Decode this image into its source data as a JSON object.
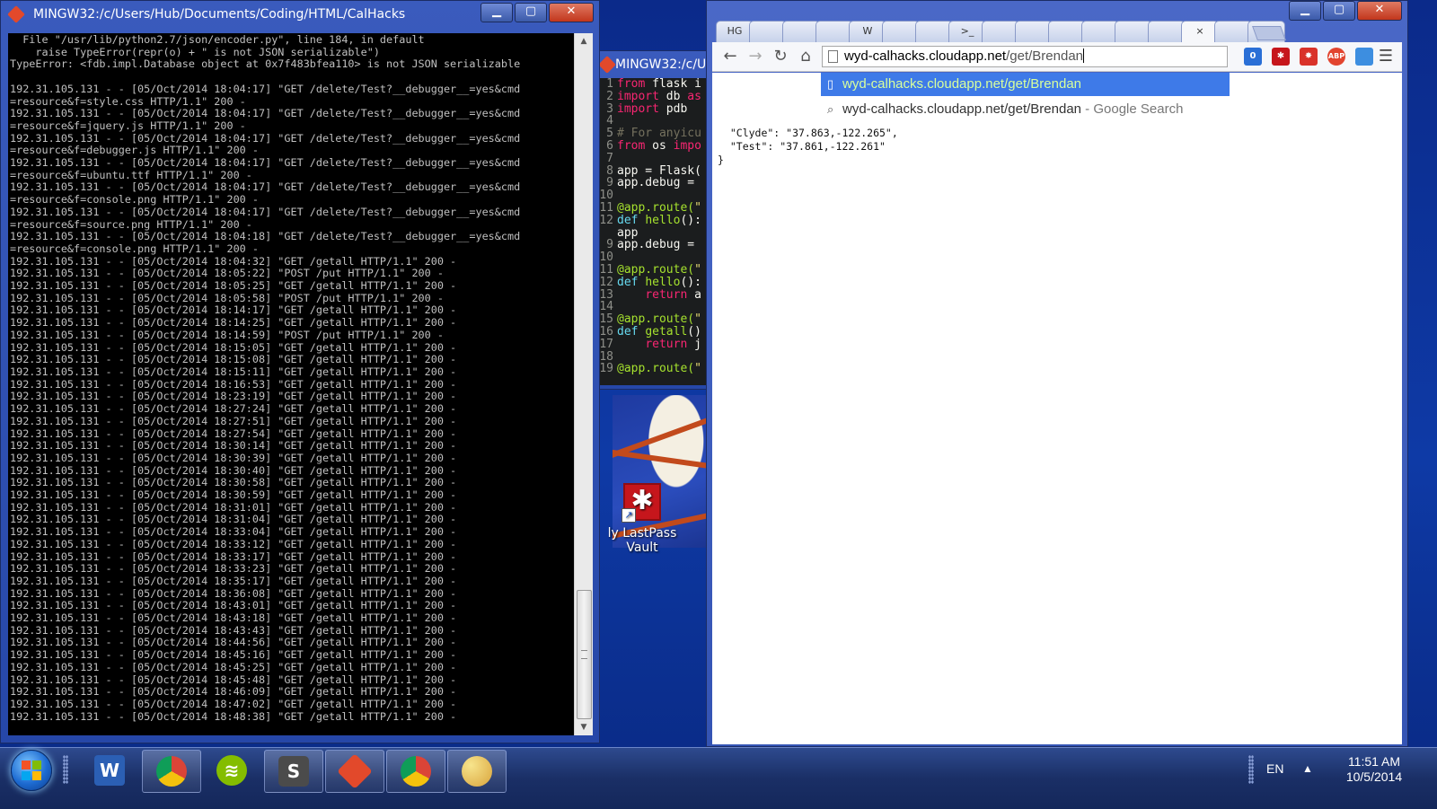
{
  "terminal_main": {
    "title": "MINGW32:/c/Users/Hub/Documents/Coding/HTML/CalHacks",
    "lines": [
      "  File \"/usr/lib/python2.7/json/encoder.py\", line 184, in default",
      "    raise TypeError(repr(o) + \" is not JSON serializable\")",
      "TypeError: <fdb.impl.Database object at 0x7f483bfea110> is not JSON serializable",
      "",
      "192.31.105.131 - - [05/Oct/2014 18:04:17] \"GET /delete/Test?__debugger__=yes&cmd",
      "=resource&f=style.css HTTP/1.1\" 200 -",
      "192.31.105.131 - - [05/Oct/2014 18:04:17] \"GET /delete/Test?__debugger__=yes&cmd",
      "=resource&f=jquery.js HTTP/1.1\" 200 -",
      "192.31.105.131 - - [05/Oct/2014 18:04:17] \"GET /delete/Test?__debugger__=yes&cmd",
      "=resource&f=debugger.js HTTP/1.1\" 200 -",
      "192.31.105.131 - - [05/Oct/2014 18:04:17] \"GET /delete/Test?__debugger__=yes&cmd",
      "=resource&f=ubuntu.ttf HTTP/1.1\" 200 -",
      "192.31.105.131 - - [05/Oct/2014 18:04:17] \"GET /delete/Test?__debugger__=yes&cmd",
      "=resource&f=console.png HTTP/1.1\" 200 -",
      "192.31.105.131 - - [05/Oct/2014 18:04:17] \"GET /delete/Test?__debugger__=yes&cmd",
      "=resource&f=source.png HTTP/1.1\" 200 -",
      "192.31.105.131 - - [05/Oct/2014 18:04:18] \"GET /delete/Test?__debugger__=yes&cmd",
      "=resource&f=console.png HTTP/1.1\" 200 -",
      "192.31.105.131 - - [05/Oct/2014 18:04:32] \"GET /getall HTTP/1.1\" 200 -",
      "192.31.105.131 - - [05/Oct/2014 18:05:22] \"POST /put HTTP/1.1\" 200 -",
      "192.31.105.131 - - [05/Oct/2014 18:05:25] \"GET /getall HTTP/1.1\" 200 -",
      "192.31.105.131 - - [05/Oct/2014 18:05:58] \"POST /put HTTP/1.1\" 200 -",
      "192.31.105.131 - - [05/Oct/2014 18:14:17] \"GET /getall HTTP/1.1\" 200 -",
      "192.31.105.131 - - [05/Oct/2014 18:14:25] \"GET /getall HTTP/1.1\" 200 -",
      "192.31.105.131 - - [05/Oct/2014 18:14:59] \"POST /put HTTP/1.1\" 200 -",
      "192.31.105.131 - - [05/Oct/2014 18:15:05] \"GET /getall HTTP/1.1\" 200 -",
      "192.31.105.131 - - [05/Oct/2014 18:15:08] \"GET /getall HTTP/1.1\" 200 -",
      "192.31.105.131 - - [05/Oct/2014 18:15:11] \"GET /getall HTTP/1.1\" 200 -",
      "192.31.105.131 - - [05/Oct/2014 18:16:53] \"GET /getall HTTP/1.1\" 200 -",
      "192.31.105.131 - - [05/Oct/2014 18:23:19] \"GET /getall HTTP/1.1\" 200 -",
      "192.31.105.131 - - [05/Oct/2014 18:27:24] \"GET /getall HTTP/1.1\" 200 -",
      "192.31.105.131 - - [05/Oct/2014 18:27:51] \"GET /getall HTTP/1.1\" 200 -",
      "192.31.105.131 - - [05/Oct/2014 18:27:54] \"GET /getall HTTP/1.1\" 200 -",
      "192.31.105.131 - - [05/Oct/2014 18:30:14] \"GET /getall HTTP/1.1\" 200 -",
      "192.31.105.131 - - [05/Oct/2014 18:30:39] \"GET /getall HTTP/1.1\" 200 -",
      "192.31.105.131 - - [05/Oct/2014 18:30:40] \"GET /getall HTTP/1.1\" 200 -",
      "192.31.105.131 - - [05/Oct/2014 18:30:58] \"GET /getall HTTP/1.1\" 200 -",
      "192.31.105.131 - - [05/Oct/2014 18:30:59] \"GET /getall HTTP/1.1\" 200 -",
      "192.31.105.131 - - [05/Oct/2014 18:31:01] \"GET /getall HTTP/1.1\" 200 -",
      "192.31.105.131 - - [05/Oct/2014 18:31:04] \"GET /getall HTTP/1.1\" 200 -",
      "192.31.105.131 - - [05/Oct/2014 18:33:04] \"GET /getall HTTP/1.1\" 200 -",
      "192.31.105.131 - - [05/Oct/2014 18:33:12] \"GET /getall HTTP/1.1\" 200 -",
      "192.31.105.131 - - [05/Oct/2014 18:33:17] \"GET /getall HTTP/1.1\" 200 -",
      "192.31.105.131 - - [05/Oct/2014 18:33:23] \"GET /getall HTTP/1.1\" 200 -",
      "192.31.105.131 - - [05/Oct/2014 18:35:17] \"GET /getall HTTP/1.1\" 200 -",
      "192.31.105.131 - - [05/Oct/2014 18:36:08] \"GET /getall HTTP/1.1\" 200 -",
      "192.31.105.131 - - [05/Oct/2014 18:43:01] \"GET /getall HTTP/1.1\" 200 -",
      "192.31.105.131 - - [05/Oct/2014 18:43:18] \"GET /getall HTTP/1.1\" 200 -",
      "192.31.105.131 - - [05/Oct/2014 18:43:43] \"GET /getall HTTP/1.1\" 200 -",
      "192.31.105.131 - - [05/Oct/2014 18:44:56] \"GET /getall HTTP/1.1\" 200 -",
      "192.31.105.131 - - [05/Oct/2014 18:45:16] \"GET /getall HTTP/1.1\" 200 -",
      "192.31.105.131 - - [05/Oct/2014 18:45:25] \"GET /getall HTTP/1.1\" 200 -",
      "192.31.105.131 - - [05/Oct/2014 18:45:48] \"GET /getall HTTP/1.1\" 200 -",
      "192.31.105.131 - - [05/Oct/2014 18:46:09] \"GET /getall HTTP/1.1\" 200 -",
      "192.31.105.131 - - [05/Oct/2014 18:47:02] \"GET /getall HTTP/1.1\" 200 -",
      "192.31.105.131 - - [05/Oct/2014 18:48:38] \"GET /getall HTTP/1.1\" 200 -"
    ]
  },
  "terminal_secondary": {
    "title": "MINGW32:/c/Us",
    "code_lines": [
      {
        "n": "1",
        "parts": [
          [
            "kw",
            "from "
          ],
          [
            "tx",
            "flask i"
          ]
        ]
      },
      {
        "n": "2",
        "parts": [
          [
            "kw",
            "import "
          ],
          [
            "tx",
            "db "
          ],
          [
            "kw",
            "as"
          ]
        ]
      },
      {
        "n": "3",
        "parts": [
          [
            "kw",
            "import "
          ],
          [
            "tx",
            "pdb"
          ]
        ]
      },
      {
        "n": "4",
        "parts": []
      },
      {
        "n": "5",
        "parts": [
          [
            "cm",
            "# For anyicu"
          ]
        ]
      },
      {
        "n": "6",
        "parts": [
          [
            "kw",
            "from "
          ],
          [
            "tx",
            "os "
          ],
          [
            "kw",
            "impo"
          ]
        ]
      },
      {
        "n": "7",
        "parts": []
      },
      {
        "n": "8",
        "parts": [
          [
            "tx",
            "app = Flask("
          ]
        ]
      },
      {
        "n": "9",
        "parts": [
          [
            "tx",
            "app.debug = "
          ]
        ]
      },
      {
        "n": "10",
        "parts": []
      },
      {
        "n": "11",
        "parts": [
          [
            "dec",
            "@app.route("
          ],
          [
            "st",
            "\""
          ]
        ]
      },
      {
        "n": "12",
        "parts": [
          [
            "fn",
            "def "
          ],
          [
            "dec",
            "hello"
          ],
          [
            "tx",
            "():"
          ]
        ]
      },
      {
        "n": "",
        "parts": [
          [
            "tx",
            "app"
          ]
        ]
      },
      {
        "n": "9",
        "parts": [
          [
            "tx",
            "app.debug = "
          ]
        ]
      },
      {
        "n": "10",
        "parts": []
      },
      {
        "n": "11",
        "parts": [
          [
            "dec",
            "@app.route("
          ],
          [
            "st",
            "\""
          ]
        ]
      },
      {
        "n": "12",
        "parts": [
          [
            "fn",
            "def "
          ],
          [
            "dec",
            "hello"
          ],
          [
            "tx",
            "():"
          ]
        ]
      },
      {
        "n": "13",
        "parts": [
          [
            "tx",
            "    "
          ],
          [
            "kw",
            "return "
          ],
          [
            "tx",
            "a"
          ]
        ]
      },
      {
        "n": "14",
        "parts": []
      },
      {
        "n": "15",
        "parts": [
          [
            "dec",
            "@app.route("
          ],
          [
            "st",
            "\""
          ]
        ]
      },
      {
        "n": "16",
        "parts": [
          [
            "fn",
            "def "
          ],
          [
            "dec",
            "getall"
          ],
          [
            "tx",
            "()"
          ]
        ]
      },
      {
        "n": "17",
        "parts": [
          [
            "tx",
            "    "
          ],
          [
            "kw",
            "return "
          ],
          [
            "tx",
            "j"
          ]
        ]
      },
      {
        "n": "18",
        "parts": []
      },
      {
        "n": "19",
        "parts": [
          [
            "dec",
            "@app.route("
          ],
          [
            "st",
            "\""
          ]
        ]
      }
    ]
  },
  "desktop": {
    "icon_label_line1": "ly LastPass",
    "icon_label_line2": "Vault",
    "icon_glyph": "✱"
  },
  "browser": {
    "tabs": [
      "HG",
      "",
      "",
      "",
      "W",
      "",
      "",
      ">_",
      "",
      "",
      "",
      "",
      "",
      "",
      "×",
      "",
      ""
    ],
    "url_host": "wyd-calhacks.cloudapp.net",
    "url_path": "/get/Brendan",
    "suggestions": [
      {
        "text": "wyd-calhacks.cloudapp.net/get/Brendan",
        "hint": ""
      },
      {
        "text": "wyd-calhacks.cloudapp.net/get/Brendan",
        "hint": " - Google Search"
      }
    ],
    "extensions": [
      {
        "label": "0",
        "color": "#2a6fd6"
      },
      {
        "label": "✱",
        "color": "#c6161c"
      },
      {
        "label": "✸",
        "color": "#d9322a"
      },
      {
        "label": "ABP",
        "color": "#e2442f"
      },
      {
        "label": "",
        "color": "#3d8ee0"
      }
    ],
    "json_lines": [
      "  \"Clyde\": \"37.863,-122.265\",",
      "  \"Test\": \"37.861,-122.261\"",
      "}"
    ]
  },
  "taskbar": {
    "items": [
      "word",
      "chrome",
      "spotify",
      "sublime",
      "git",
      "chrome",
      "paint"
    ],
    "language": "EN",
    "time": "11:51 AM",
    "date": "10/5/2014"
  }
}
